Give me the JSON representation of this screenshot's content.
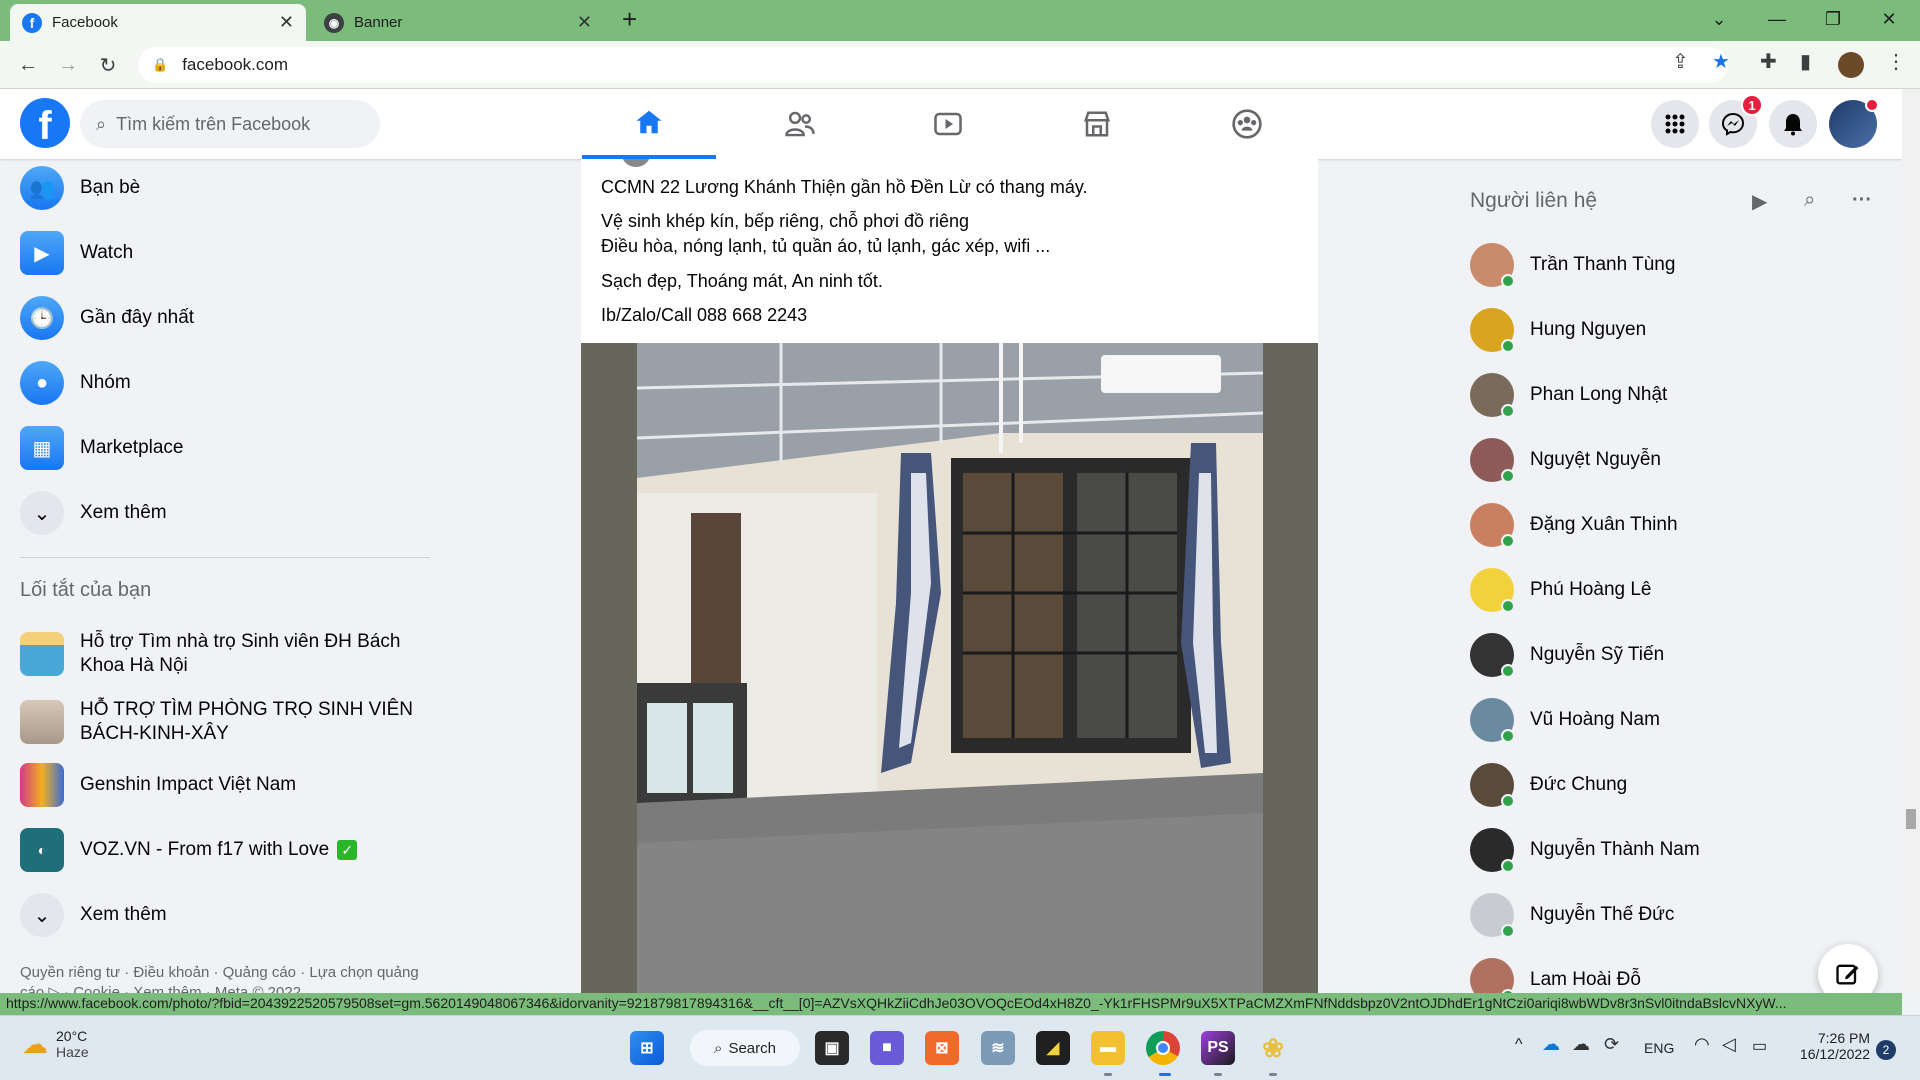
{
  "browser": {
    "tabs": [
      {
        "title": "Facebook",
        "favicon": "facebook-icon",
        "active": true
      },
      {
        "title": "Banner",
        "favicon": "globe-icon",
        "active": false
      }
    ],
    "new_tab_label": "+",
    "url": "facebook.com"
  },
  "facebook": {
    "search_placeholder": "Tìm kiếm trên Facebook",
    "notification_badge": "1",
    "brand_color": "#1877f2",
    "nav_items": [
      "home-icon",
      "friends-icon",
      "watch-icon",
      "marketplace-icon",
      "groups-icon"
    ]
  },
  "left_nav": {
    "items": [
      {
        "label": "Bạn bè",
        "icon": "friends-icon"
      },
      {
        "label": "Watch",
        "icon": "watch-icon"
      },
      {
        "label": "Gần đây nhất",
        "icon": "recent-icon"
      },
      {
        "label": "Nhóm",
        "icon": "groups-icon"
      },
      {
        "label": "Marketplace",
        "icon": "marketplace-icon"
      },
      {
        "label": "Xem thêm",
        "icon": "chevron-down-icon"
      }
    ],
    "shortcuts_title": "Lối tắt của bạn",
    "shortcuts": [
      {
        "label": "Hỗ trợ Tìm nhà trọ Sinh viên ĐH Bách Khoa Hà Nội"
      },
      {
        "label": "HỖ TRỢ TÌM PHÒNG TRỌ SINH VIÊN BÁCH-KINH-XÂY"
      },
      {
        "label": "Genshin Impact Việt Nam"
      },
      {
        "label": "VOZ.VN - From f17 with Love"
      }
    ],
    "shortcuts_more": "Xem thêm",
    "footer": "Quyền riêng tư · Điều khoản · Quảng cáo · Lựa chọn quảng cáo ▷ · Cookie · Xem thêm · Meta © 2022"
  },
  "post": {
    "lines": [
      "CCMN 22 Lương Khánh Thiện gần hồ Đền Lừ có thang máy.",
      "Vệ sinh khép kín, bếp riêng, chỗ phơi đồ riêng",
      "Điều hòa, nóng lạnh, tủ quần áo, tủ lạnh, gác xép, wifi ...",
      "Sạch đẹp, Thoáng mát, An ninh tốt.",
      "Ib/Zalo/Call 088 668 2243"
    ]
  },
  "contacts": {
    "title": "Người liên hệ",
    "list": [
      {
        "name": "Trần Thanh Tùng",
        "color": "#c98b6b"
      },
      {
        "name": "Hung Nguyen",
        "color": "#d9a520"
      },
      {
        "name": "Phan Long Nhật",
        "color": "#7a6a5a"
      },
      {
        "name": "Nguyệt Nguyễn",
        "color": "#8e5a5a"
      },
      {
        "name": "Đặng Xuân Thinh",
        "color": "#c88060"
      },
      {
        "name": "Phú Hoàng Lê",
        "color": "#f2d23c"
      },
      {
        "name": "Nguyễn Sỹ Tiến",
        "color": "#333333"
      },
      {
        "name": "Vũ Hoàng Nam",
        "color": "#6a8aa0"
      },
      {
        "name": "Đức Chung",
        "color": "#5a4a3a"
      },
      {
        "name": "Nguyễn Thành Nam",
        "color": "#2a2a2a"
      },
      {
        "name": "Nguyễn Thế Đức",
        "color": "#c8cbd0"
      },
      {
        "name": "Lam Hoài Đỗ",
        "color": "#b07060"
      }
    ]
  },
  "status_url": "https://www.facebook.com/photo/?fbid=2043922520579508set=gm.5620149048067346&idorvanity=921879817894316&__cft__[0]=AZVsXQHkZiiCdhJe03OVOQcEOd4xH8Z0_-Yk1rFHSPMr9uX5XTPaCMZXmFNfNddsbpz0V2ntOJDhdEr1gNtCzi0ariqi8wbWDv8r3nSvl0itndaBslcvNXyW...",
  "taskbar": {
    "weather_temp": "20°C",
    "weather_desc": "Haze",
    "search_label": "Search",
    "language": "ENG",
    "time": "7:26 PM",
    "date": "16/12/2022",
    "notification_count": "2"
  }
}
